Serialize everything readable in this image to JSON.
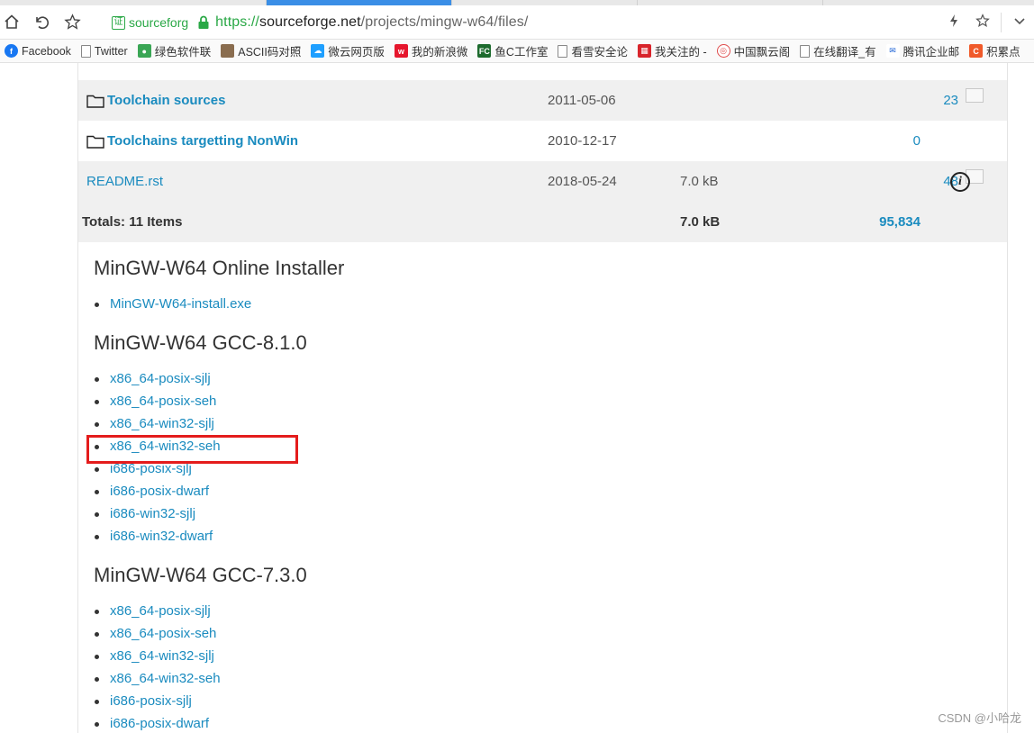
{
  "browser": {
    "cert_label": "sourceforg",
    "url": {
      "scheme": "https://",
      "host": "sourceforge.net",
      "path": "/projects/mingw-w64/files/"
    },
    "bookmarks": [
      {
        "label": "Facebook",
        "icon": "facebook-icon",
        "color": "#1877f2"
      },
      {
        "label": "Twitter",
        "icon": "page-icon",
        "color": "#ffffff"
      },
      {
        "label": "绿色软件联",
        "icon": "app-icon",
        "color": "#3aa655"
      },
      {
        "label": "ASCII码对照",
        "icon": "photo-icon",
        "color": "#8a6d4f"
      },
      {
        "label": "微云网页版",
        "icon": "cloud-icon",
        "color": "#1e9fff"
      },
      {
        "label": "我的新浪微",
        "icon": "weibo-icon",
        "color": "#e6162d"
      },
      {
        "label": "鱼C工作室",
        "icon": "fc-icon",
        "color": "#1d6b2e"
      },
      {
        "label": "看雪安全论",
        "icon": "page-icon",
        "color": "#ffffff"
      },
      {
        "label": "我关注的 -",
        "icon": "grid-icon",
        "color": "#d8242b"
      },
      {
        "label": "中国飘云阁",
        "icon": "shield-icon",
        "color": "#e04d4d"
      },
      {
        "label": "在线翻译_有",
        "icon": "page-icon",
        "color": "#ffffff"
      },
      {
        "label": "腾讯企业邮",
        "icon": "mail-icon",
        "color": "#1e63d6"
      },
      {
        "label": "积累点",
        "icon": "c-icon",
        "color": "#f05a2a"
      }
    ]
  },
  "files": {
    "rows": [
      {
        "name": "Toolchain sources",
        "type": "folder",
        "date": "2011-05-06",
        "size": "",
        "downloads": "23",
        "has_chart": true,
        "has_info": false,
        "shaded": true
      },
      {
        "name": "Toolchains targetting NonWin",
        "type": "folder",
        "date": "2010-12-17",
        "size": "",
        "downloads": "0",
        "has_chart": false,
        "has_info": false,
        "shaded": false
      },
      {
        "name": "README.rst",
        "type": "file",
        "date": "2018-05-24",
        "size": "7.0 kB",
        "downloads": "48",
        "has_chart": true,
        "has_info": true,
        "shaded": true
      }
    ],
    "totals": {
      "label": "Totals: 11 Items",
      "size": "7.0 kB",
      "downloads": "95,834"
    }
  },
  "sections": [
    {
      "title": "MinGW-W64 Online Installer",
      "links": [
        "MinGW-W64-install.exe"
      ]
    },
    {
      "title": "MinGW-W64 GCC-8.1.0",
      "links": [
        "x86_64-posix-sjlj",
        "x86_64-posix-seh",
        "x86_64-win32-sjlj",
        "x86_64-win32-seh",
        "i686-posix-sjlj",
        "i686-posix-dwarf",
        "i686-win32-sjlj",
        "i686-win32-dwarf"
      ]
    },
    {
      "title": "MinGW-W64 GCC-7.3.0",
      "links": [
        "x86_64-posix-sjlj",
        "x86_64-posix-seh",
        "x86_64-win32-sjlj",
        "x86_64-win32-seh",
        "i686-posix-sjlj",
        "i686-posix-dwarf"
      ]
    }
  ],
  "highlight": {
    "section": 1,
    "link": 3,
    "color": "#e41c1c"
  },
  "watermark": "CSDN @小哈龙"
}
